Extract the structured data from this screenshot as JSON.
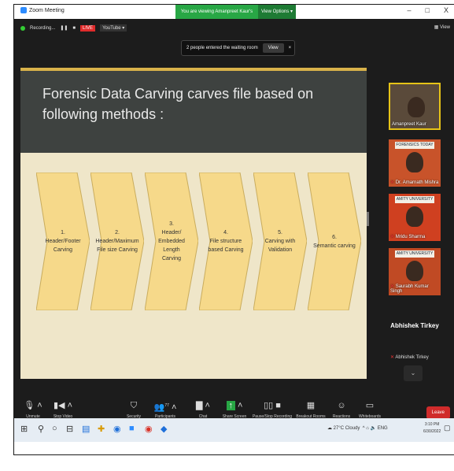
{
  "window": {
    "title": "Zoom Meeting",
    "viewing_banner": "You are viewing Amanpreet Kaur's screen",
    "view_options": "View Options",
    "minimize": "–",
    "maximize": "□",
    "close": "X"
  },
  "topbar": {
    "recording": "Recording...",
    "pause": "❚❚",
    "stop": "■",
    "live_badge": "LIVE",
    "youtube": "YouTube ▾",
    "view_label": "View"
  },
  "waiting_popup": {
    "message": "2 people entered the waiting room",
    "view_button": "View",
    "close": "×"
  },
  "slide": {
    "title": "Forensic Data Carving carves file based on following methods :",
    "methods": [
      {
        "label": "1.\nHeader/Footer\nCarving"
      },
      {
        "label": "2.\nHeader/Maximum\nFile size Carving"
      },
      {
        "label": "3.\nHeader/\nEmbedded Length\nCarving"
      },
      {
        "label": "4.\nFile structure\nbased Carving"
      },
      {
        "label": "5.\nCarving with\nValidation"
      },
      {
        "label": "6.\nSemantic carving"
      }
    ]
  },
  "participants": [
    {
      "name": "Amanpreet Kaur",
      "banner": ""
    },
    {
      "name": "Dr. Amarnath Mishra",
      "banner": "FORENSICS TODAY"
    },
    {
      "name": "Mridu Sharma",
      "banner": "AMITY UNIVERSITY"
    },
    {
      "name": "Saurabh Kumar Singh",
      "banner": "AMITY UNIVERSITY"
    }
  ],
  "name_only_tile": {
    "big": "Abhishek Tirkey",
    "small": "Abhishek Tirkey"
  },
  "toolbar": {
    "unmute": "Unmute",
    "stop_video": "Stop Video",
    "security": "Security",
    "participants": "Participants",
    "participants_count": "77",
    "chat": "Chat",
    "share_screen": "Share Screen",
    "pause_stop_recording": "Pause/Stop Recording",
    "breakout_rooms": "Breakout Rooms",
    "reactions": "Reactions",
    "whiteboards": "Whiteboards",
    "leave": "Leave"
  },
  "taskbar": {
    "weather": "27°C  Cloudy",
    "language": "ENG",
    "time": "3:10 PM",
    "date": "6/30/2022"
  },
  "colors": {
    "zoom_bg": "#1c1c1c",
    "slide_bg": "#efe6c9",
    "chevron_fill": "#f6d98a",
    "accent_green": "#28a745",
    "leave_red": "#d02b2b"
  }
}
